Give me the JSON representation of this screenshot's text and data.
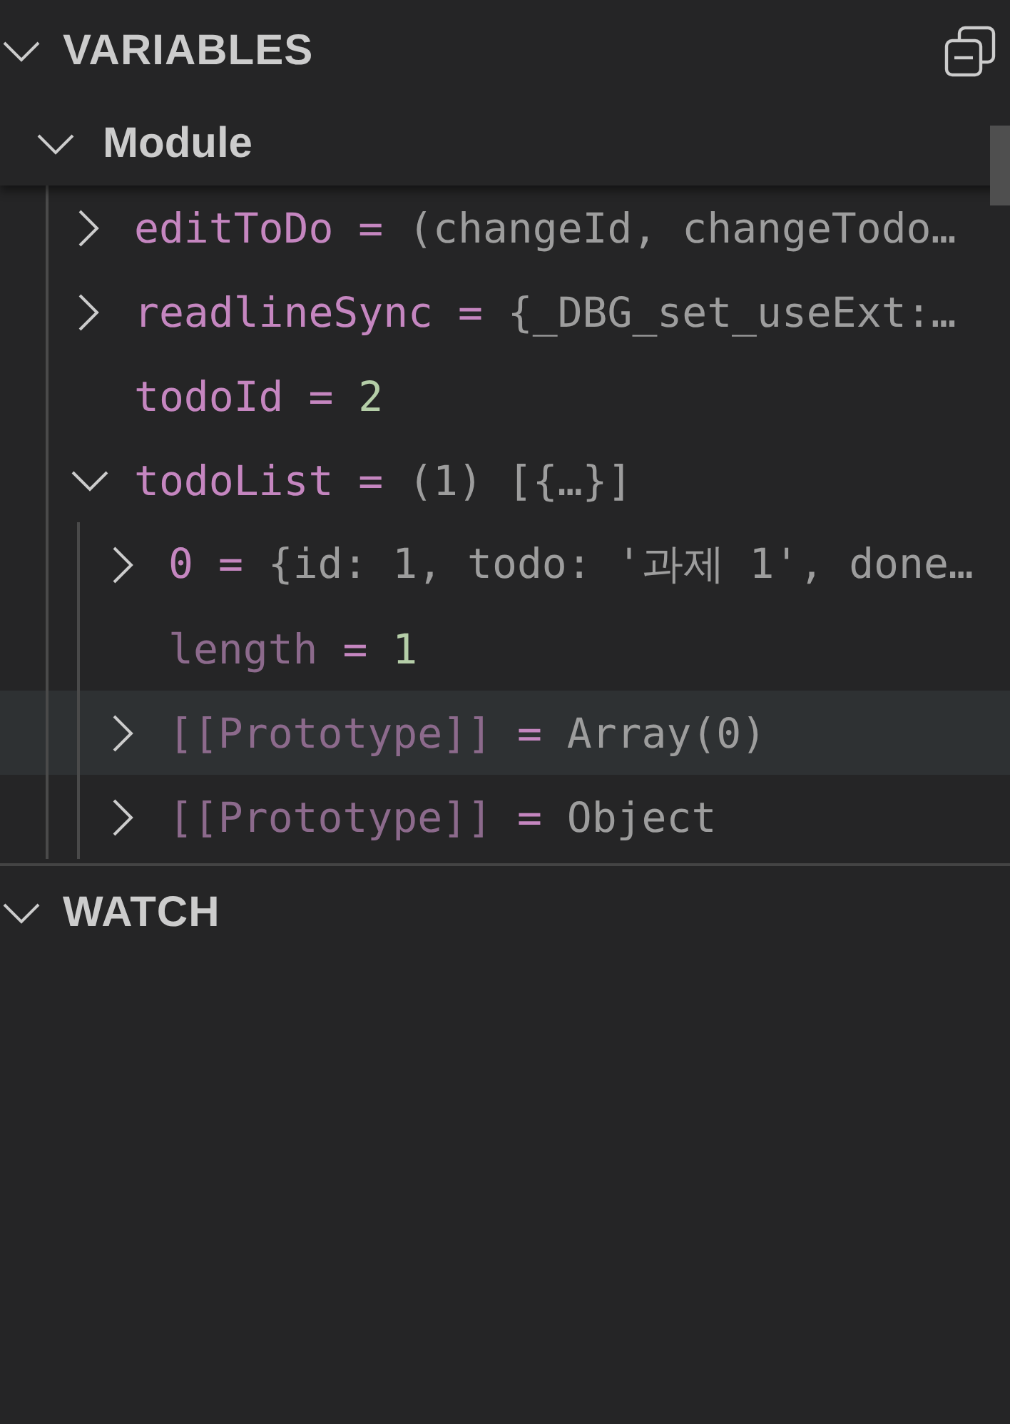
{
  "panels": [
    {
      "title": "VARIABLES",
      "expanded": true,
      "scopes": [
        {
          "name": "Module",
          "expanded": true,
          "items": [
            {
              "name": "editToDo",
              "op": "=",
              "value": "(changeId, changeTodo…",
              "kind": "object",
              "expandable": true,
              "expanded": false,
              "dimmed": false,
              "selected": false
            },
            {
              "name": "readlineSync",
              "op": "=",
              "value": "{_DBG_set_useExt:…",
              "kind": "object",
              "expandable": true,
              "expanded": false,
              "dimmed": false,
              "selected": false
            },
            {
              "name": "todoId",
              "op": "=",
              "value": "2",
              "kind": "number",
              "expandable": false,
              "dimmed": false,
              "selected": false
            },
            {
              "name": "todoList",
              "op": "=",
              "value": "(1) [{…}]",
              "kind": "object",
              "expandable": true,
              "expanded": true,
              "dimmed": false,
              "selected": false,
              "children": [
                {
                  "name": "0",
                  "op": "=",
                  "value": "{id: 1, todo: '과제 1', done…",
                  "kind": "object",
                  "expandable": true,
                  "expanded": false,
                  "dimmed": false,
                  "selected": false
                },
                {
                  "name": "length",
                  "op": "=",
                  "value": "1",
                  "kind": "number",
                  "expandable": false,
                  "dimmed": true,
                  "selected": false
                },
                {
                  "name": "[[Prototype]]",
                  "op": "=",
                  "value": "Array(0)",
                  "kind": "object",
                  "expandable": true,
                  "expanded": false,
                  "dimmed": true,
                  "selected": true
                },
                {
                  "name": "[[Prototype]]",
                  "op": "=",
                  "value": "Object",
                  "kind": "object",
                  "expandable": true,
                  "expanded": false,
                  "dimmed": true,
                  "selected": false
                }
              ]
            }
          ]
        }
      ]
    },
    {
      "title": "WATCH",
      "expanded": true
    }
  ]
}
